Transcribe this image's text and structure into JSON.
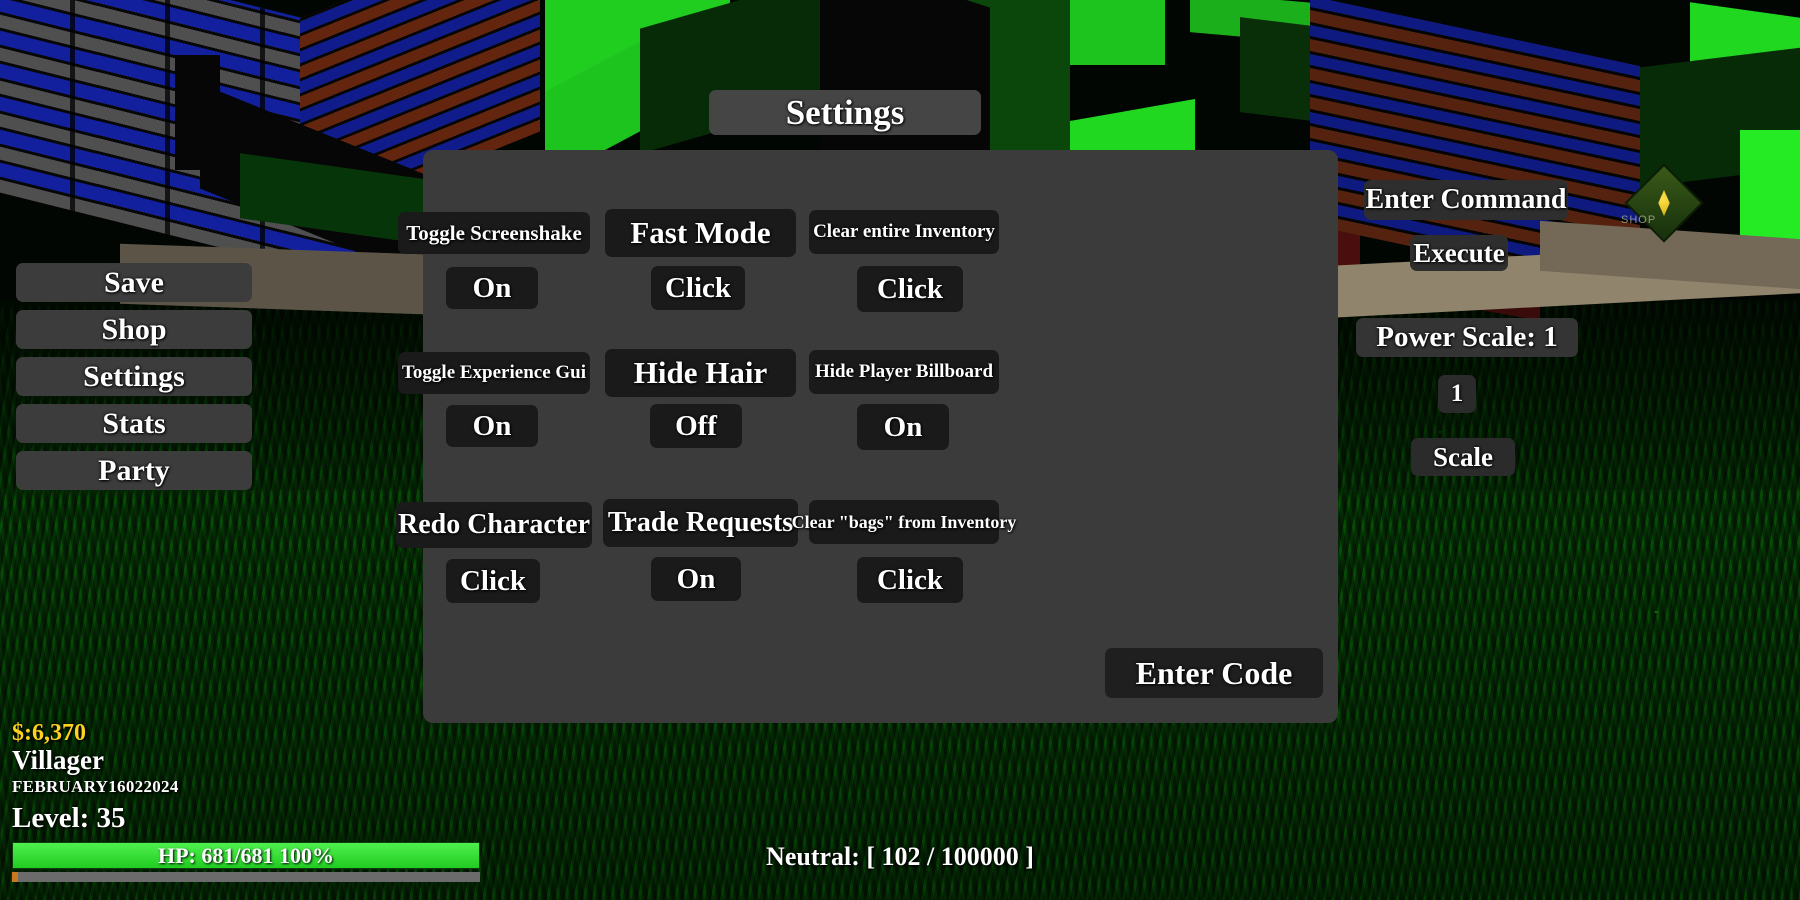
{
  "window": {
    "title": "Settings"
  },
  "left_menu": {
    "items": [
      {
        "label": "Save"
      },
      {
        "label": "Shop"
      },
      {
        "label": "Settings"
      },
      {
        "label": "Stats"
      },
      {
        "label": "Party"
      }
    ]
  },
  "settings_panel": {
    "title": "Settings",
    "rows": [
      [
        {
          "label": "Toggle Screenshake",
          "value": "On",
          "label_font_size": 21,
          "label_width": 192,
          "label_height": 42,
          "value_width": 92,
          "value_height": 42
        },
        {
          "label": "Fast Mode",
          "value": "Click",
          "label_font_size": 31,
          "label_width": 112,
          "label_height": 48,
          "value_width": 106,
          "value_height": 44
        },
        {
          "label": "Clear entire Inventory",
          "value": "Click",
          "label_font_size": 19,
          "label_width": 219,
          "label_height": 44,
          "value_width": 106,
          "value_height": 46
        }
      ],
      [
        {
          "label": "Toggle Experience Gui",
          "value": "On",
          "label_font_size": 19,
          "label_width": 192,
          "label_height": 42,
          "value_width": 92,
          "value_height": 42
        },
        {
          "label": "Hide Hair",
          "value": "Off",
          "label_font_size": 31,
          "label_width": 112,
          "label_height": 48,
          "value_width": 92,
          "value_height": 44
        },
        {
          "label": "Hide Player Billboard",
          "value": "On",
          "label_font_size": 19,
          "label_width": 219,
          "label_height": 44,
          "value_width": 92,
          "value_height": 46
        }
      ],
      [
        {
          "label": "Redo Character",
          "value": "Click",
          "label_font_size": 28,
          "label_width": 192,
          "label_height": 46,
          "value_width": 106,
          "value_height": 44
        },
        {
          "label": "Trade Requests",
          "value": "On",
          "label_font_size": 28,
          "label_width": 112,
          "label_height": 48,
          "value_width": 92,
          "value_height": 44
        },
        {
          "label": "Clear \"bags\" from Inventory",
          "value": "Click",
          "label_font_size": 18,
          "label_width": 219,
          "label_height": 44,
          "value_width": 106,
          "value_height": 46
        }
      ]
    ],
    "enter_code_label": "Enter Code"
  },
  "command_panel": {
    "enter_command_label": "Enter Command",
    "execute_label": "Execute",
    "power_scale_label": "Power Scale: 1",
    "power_scale_value": "1",
    "scale_label": "Scale"
  },
  "hud": {
    "money": "$:6,370",
    "class": "Villager",
    "date": "FEBRUARY16022024",
    "level": "Level: 35",
    "hp_text": "HP: 681/681 100%",
    "hp_percent": 100
  },
  "status": {
    "neutral": "Neutral: [ 102 / 100000 ]"
  },
  "world": {
    "shop_marker_label": "SHOP"
  },
  "colors": {
    "panel_bg": "#3b3b3b",
    "button_bg": "#1a1a1a",
    "menu_button_bg": "#3c3c3c",
    "text": "#ffffff",
    "money_text": "#ffd21e",
    "hp_bar": "#2ee62e",
    "grass": "#0d4a0d",
    "brick_blue": "#1d33ff",
    "brick_orange": "#b5441b",
    "shop_marker": "#ffe14d"
  }
}
